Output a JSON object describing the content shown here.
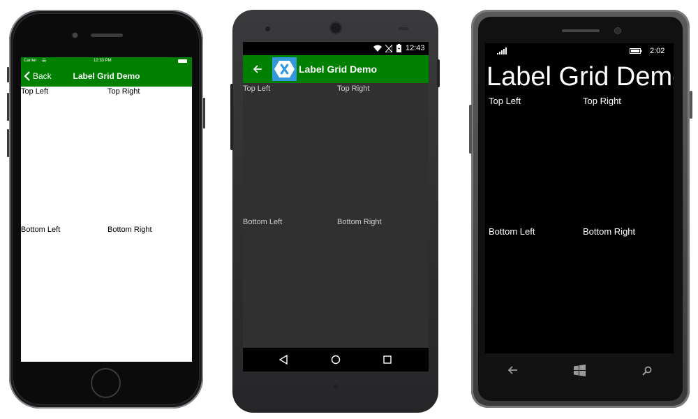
{
  "ios": {
    "status": {
      "carrier": "Carrier",
      "time": "12:33 PM"
    },
    "nav": {
      "back_label": "Back",
      "title": "Label Grid Demo"
    },
    "labels": {
      "top_left": "Top Left",
      "top_right": "Top Right",
      "bottom_left": "Bottom Left",
      "bottom_right": "Bottom Right"
    },
    "accent": "#008000"
  },
  "android": {
    "status": {
      "time": "12:43"
    },
    "app_bar": {
      "title": "Label Grid Demo"
    },
    "labels": {
      "top_left": "Top Left",
      "top_right": "Top Right",
      "bottom_left": "Bottom Left",
      "bottom_right": "Bottom Right"
    },
    "accent": "#008000",
    "logo_color": "#3498db"
  },
  "winphone": {
    "status": {
      "time": "2:02"
    },
    "page_title": "Label Grid Demo",
    "labels": {
      "top_left": "Top Left",
      "top_right": "Top Right",
      "bottom_left": "Bottom Left",
      "bottom_right": "Bottom Right"
    }
  }
}
